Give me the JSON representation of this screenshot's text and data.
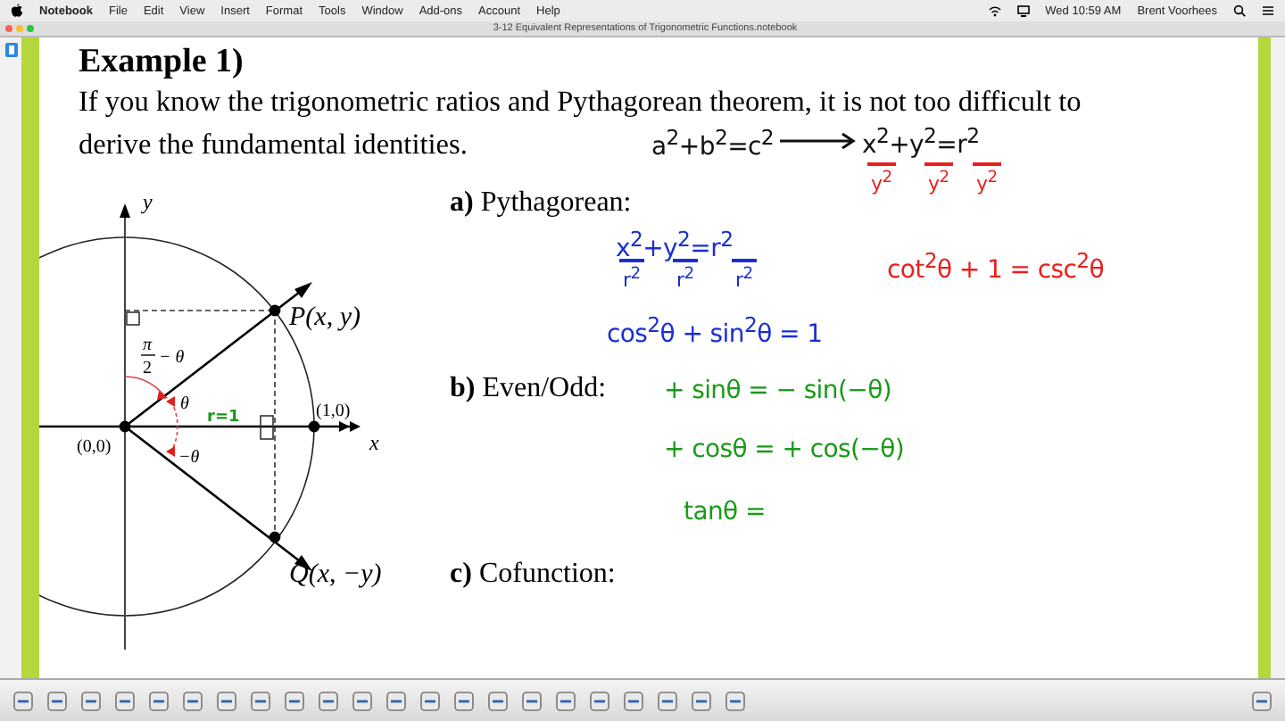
{
  "menu_bar": {
    "app": "Notebook",
    "items": [
      "File",
      "Edit",
      "View",
      "Insert",
      "Format",
      "Tools",
      "Window",
      "Add-ons",
      "Account",
      "Help"
    ],
    "clock": "Wed 10:59 AM",
    "user": "Brent Voorhees"
  },
  "window": {
    "title": "3-12 Equivalent Representations of Trigonometric Functions.notebook"
  },
  "page": {
    "heading": "Example 1)",
    "intro_lines": [
      "If you know the trigonometric ratios and Pythagorean theorem, it is not too difficult to",
      "derive the fundamental identities."
    ],
    "sections": [
      {
        "letter": "a)",
        "label": "Pythagorean:"
      },
      {
        "letter": "b)",
        "label": "Even/Odd:"
      },
      {
        "letter": "c)",
        "label": "Cofunction:"
      }
    ],
    "diagram": {
      "y_axis": "y",
      "x_axis": "x",
      "point_p": "P(x, y)",
      "point_q": "Q(x, −y)",
      "unit_point": "(1,0)",
      "origin": "(0,0)",
      "angle": "θ",
      "negative_angle": "−θ",
      "complement": {
        "numerator": "π",
        "denominator": "2",
        "rest": "− θ"
      },
      "radius_note": "r=1"
    },
    "ink": [
      {
        "kind": "expression",
        "text": "a$^{2}$+b$^{2}$=c$^{2}$",
        "color": "#111111"
      },
      {
        "kind": "arrow",
        "color": "#111111"
      },
      {
        "kind": "expression",
        "text": "x$^{2}$+y$^{2}$=r$^{2}$",
        "color": "#111111"
      },
      {
        "kind": "denominator",
        "text": "y$^{2}$",
        "color": "#e8201c"
      },
      {
        "kind": "denominator",
        "text": "y$^{2}$",
        "color": "#e8201c"
      },
      {
        "kind": "denominator",
        "text": "y$^{2}$",
        "color": "#e8201c"
      },
      {
        "kind": "expression",
        "text": "x$^{2}$+y$^{2}$=r$^{2}$",
        "color": "#1a2fd0"
      },
      {
        "kind": "denominator",
        "text": "r$^{2}$",
        "color": "#1a2fd0"
      },
      {
        "kind": "denominator",
        "text": "r$^{2}$",
        "color": "#1a2fd0"
      },
      {
        "kind": "denominator",
        "text": "r$^{2}$",
        "color": "#1a2fd0"
      },
      {
        "kind": "expression",
        "text": "cot$^{2}$θ + 1 = csc$^{2}$θ",
        "color": "#e8201c"
      },
      {
        "kind": "expression",
        "text": "cos$^{2}$θ + sin$^{2}$θ = 1",
        "color": "#1a2fd0"
      },
      {
        "kind": "expression",
        "text": "+ sinθ = − sin(−θ)",
        "color": "#1a9a1a"
      },
      {
        "kind": "expression",
        "text": "+ cosθ = + cos(−θ)",
        "color": "#1a9a1a"
      },
      {
        "kind": "expression",
        "text": "tanθ =",
        "color": "#1a9a1a"
      }
    ]
  }
}
